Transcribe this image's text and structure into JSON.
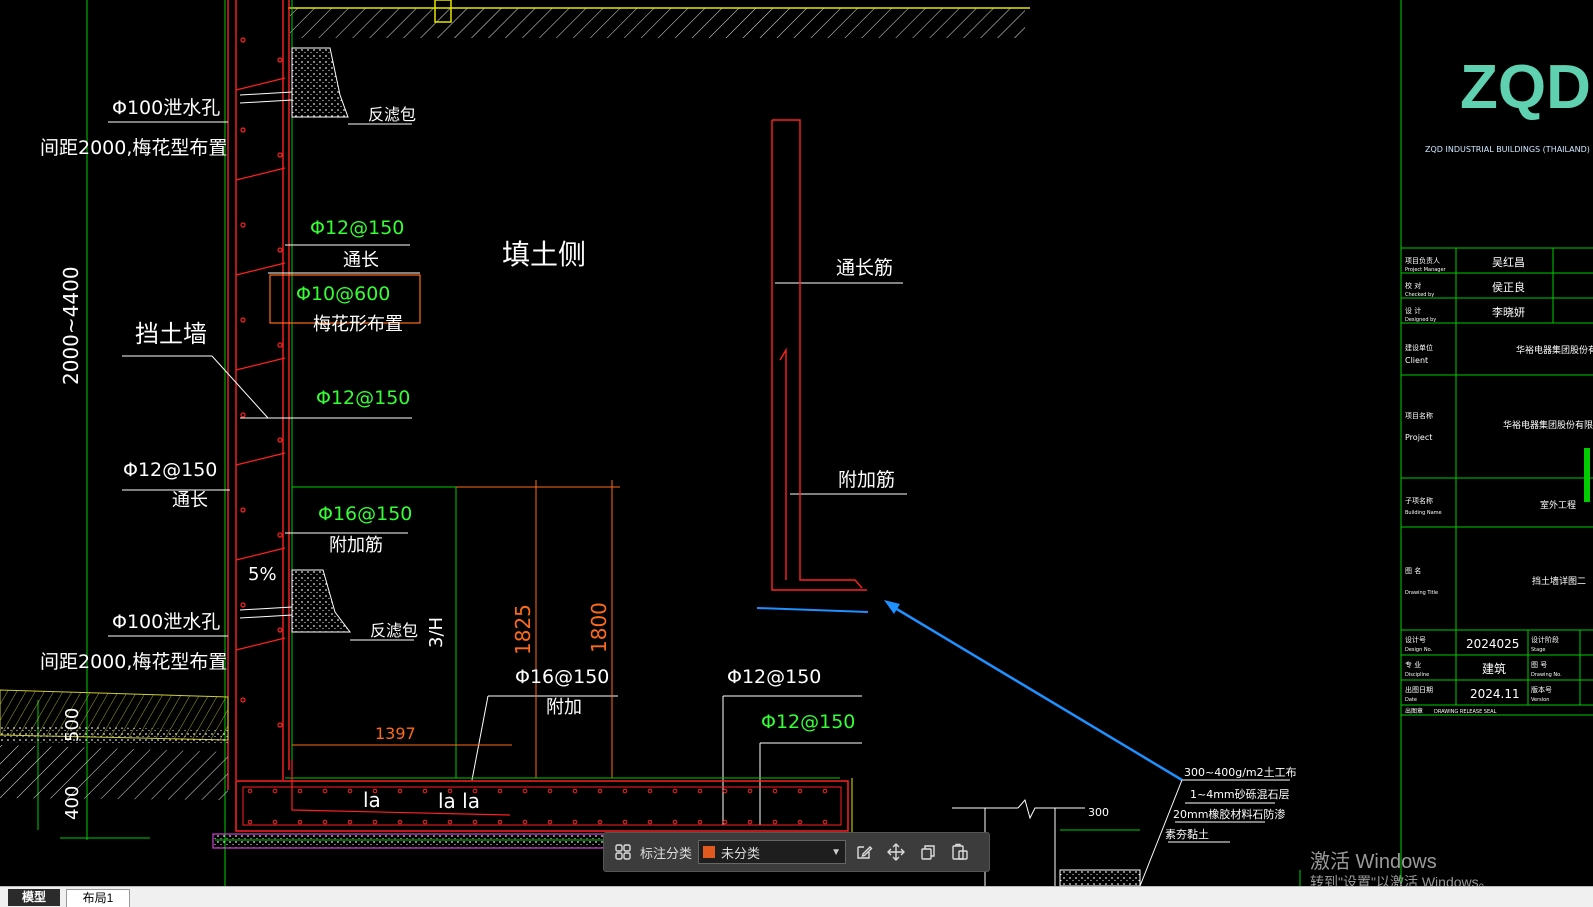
{
  "colors": {
    "background": "#000000",
    "green_line": "#00cc00",
    "red_rebar": "#ff2020",
    "orange_dim": "#ff6a1a",
    "white_text": "#ffffff",
    "green_text": "#33ff33",
    "yellow": "#e6e600",
    "magenta": "#d040d0",
    "blue_arrow": "#1e90ff",
    "logo_teal": "#5fd0b0"
  },
  "drawing": {
    "labels": {
      "drain_hole_top": "Φ100泄水孔",
      "spacing_top": "间距2000,梅花型布置",
      "filter_top": "反滤包",
      "rebar_12_150_a": "Φ12@150",
      "through_a": "通长",
      "rebar_10_600": "Φ10@600",
      "plum_layout": "梅花形布置",
      "fill_side": "填土侧",
      "retaining_wall": "挡土墙",
      "rebar_12_150_b": "Φ12@150",
      "rebar_12_150_c": "Φ12@150",
      "through_b": "通长",
      "height_range": "2000~4400",
      "rebar_16_150_a": "Φ16@150",
      "additional_a": "附加筋",
      "slope": "5%",
      "drain_hole_bottom": "Φ100泄水孔",
      "filter_bottom": "反滤包",
      "spacing_bottom": "间距2000,梅花型布置",
      "three_h": "3/H",
      "dim_1825": "1825",
      "dim_1800": "1800",
      "rebar_16_150_b": "Φ16@150",
      "additional_b": "附加",
      "rebar_12_150_d": "Φ12@150",
      "rebar_12_150_e": "Φ12@150",
      "dim_1397": "1397",
      "la_1": "la",
      "la_2": "la la",
      "dim_500": "500",
      "dim_400": "400",
      "through_rebar": "通长筋",
      "additional_rebar": "附加筋",
      "geo": "300~400g/m2土工布",
      "gravel": "1~4mm砂砾混石层",
      "rubber": "20mm橡胶材料石防渗",
      "soil": "素夯黏土",
      "dim_300": "300"
    }
  },
  "title_block": {
    "logo": "ZQD",
    "company": "ZQD INDUSTRIAL   BUILDINGS   (THAILAND)",
    "rows": [
      {
        "label_cn": "项目负责人",
        "label_en": "Project Manager",
        "value": "吴红昌"
      },
      {
        "label_cn": "校   对",
        "label_en": "Checked by",
        "value": "侯正良"
      },
      {
        "label_cn": "设   计",
        "label_en": "Designed by",
        "value": "李晓妍"
      }
    ],
    "client_cn": "建设单位",
    "client_en": "Client",
    "client_value": "华裕电器集团股份有限公司",
    "project_cn": "项目名称",
    "project_en": "Project",
    "project_value": "华裕电器集团股份有限公司泰国",
    "building_cn": "子项名称",
    "building_en": "Building Name",
    "building_value": "室外工程",
    "title_cn": "图   名",
    "title_en": "Drawing Title",
    "title_value": "挡土墙详图二",
    "design_no_cn": "设计号",
    "design_no_en": "Design No.",
    "design_no_value": "2024025",
    "stage_cn": "设计阶段",
    "stage_en": "Stage",
    "discipline_cn": "专   业",
    "discipline_en": "Discipline",
    "discipline_value": "建筑",
    "drawing_no_cn": "图   号",
    "drawing_no_en": "Drawing No.",
    "date_cn": "出图日期",
    "date_en": "Date",
    "date_value": "2024.11",
    "version_cn": "版本号",
    "version_en": "Version",
    "seal_cn": "出图章",
    "seal_en": "DRAWING RELEASE SEAL"
  },
  "toolbar": {
    "label": "标注分类",
    "select_value": "未分类",
    "select_swatch": "#e05a20"
  },
  "tabs": [
    {
      "label": "模型",
      "active": true
    },
    {
      "label": "布局1",
      "active": false
    }
  ],
  "watermark": {
    "line1": "激活 Windows",
    "line2": "转到\"设置\"以激活 Windows。"
  }
}
